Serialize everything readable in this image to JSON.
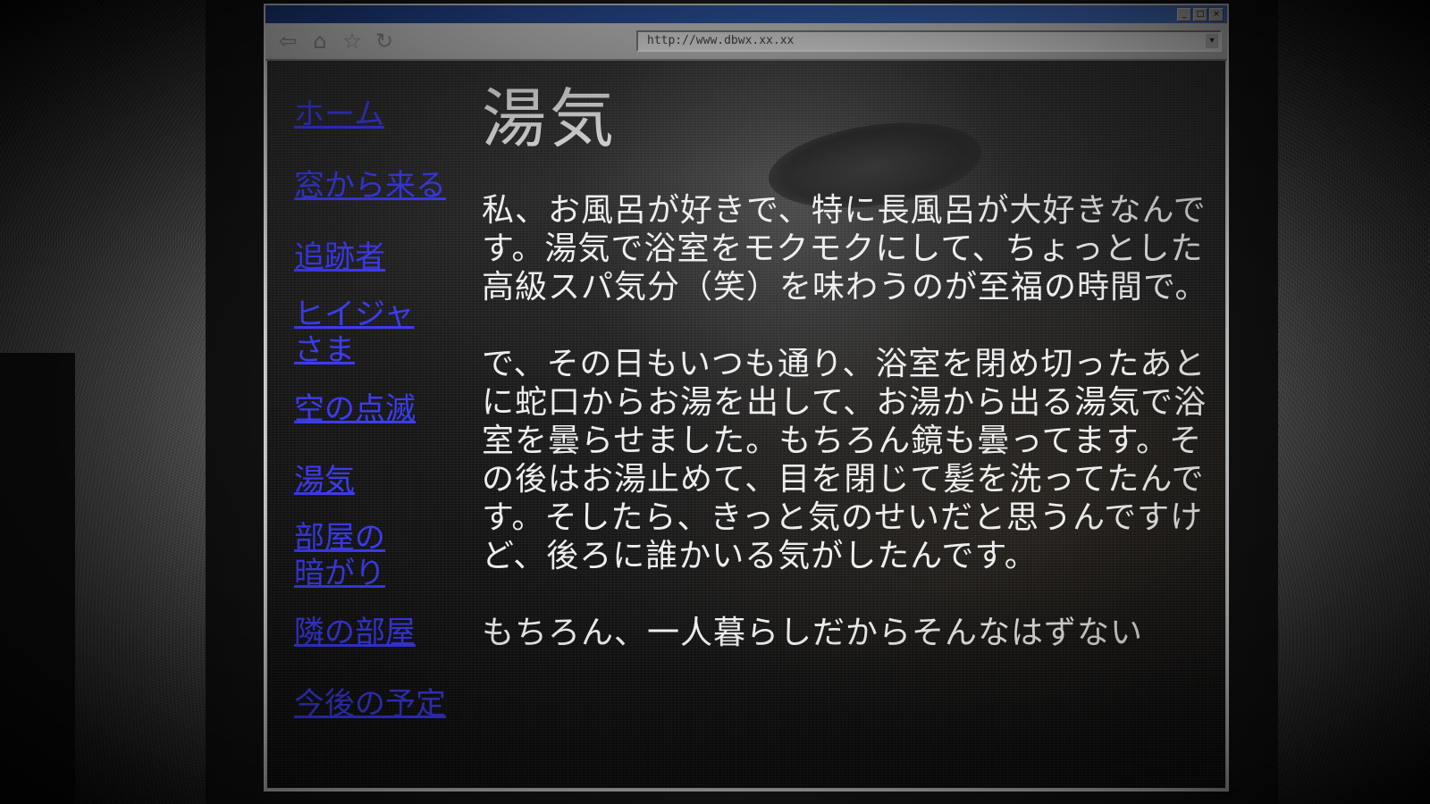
{
  "browser": {
    "url": "http://www.dbwx.xx.xx",
    "window_controls": [
      "_",
      "□",
      "×"
    ],
    "nav_icons": [
      "back-icon",
      "home-icon",
      "star-icon",
      "refresh-icon"
    ]
  },
  "sidebar": {
    "items": [
      {
        "label": "ホーム"
      },
      {
        "label": "窓から来る"
      },
      {
        "label": "追跡者"
      },
      {
        "label": "ヒイジャさま"
      },
      {
        "label": "空の点滅"
      },
      {
        "label": "湯気"
      },
      {
        "label": "部屋の暗がり"
      },
      {
        "label": "隣の部屋"
      },
      {
        "label": "今後の予定"
      }
    ]
  },
  "main": {
    "title": "湯気",
    "paragraphs": [
      "私、お風呂が好きで、特に長風呂が大好きなんです。湯気で浴室をモクモクにして、ちょっとした高級スパ気分（笑）を味わうのが至福の時間で。",
      "で、その日もいつも通り、浴室を閉め切ったあとに蛇口からお湯を出して、お湯から出る湯気で浴室を曇らせました。もちろん鏡も曇ってます。その後はお湯止めて、目を閉じて髪を洗ってたんです。そしたら、きっと気のせいだと思うんですけど、後ろに誰かいる気がしたんです。",
      "もちろん、一人暮らしだからそんなはずない"
    ]
  },
  "colors": {
    "link": "#3c3cf0",
    "text": "#eeeeee",
    "titlebar": "#3762b8"
  }
}
